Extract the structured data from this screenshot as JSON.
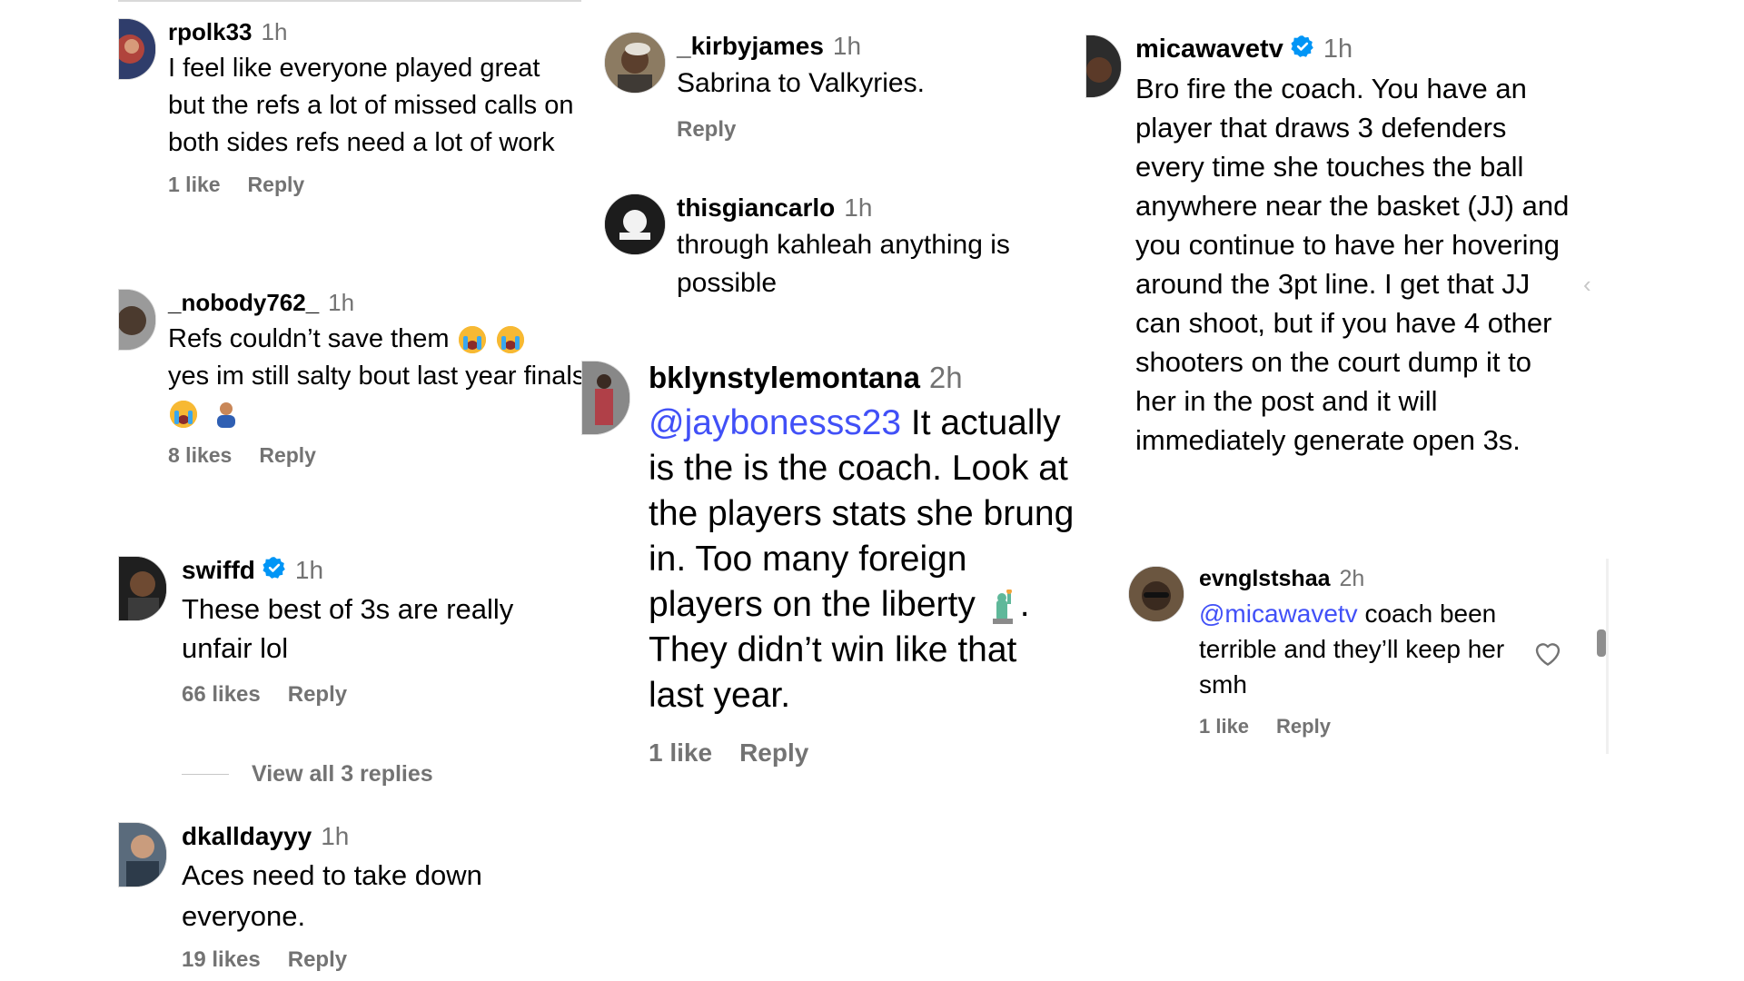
{
  "comments": [
    {
      "user": "rpolk33",
      "time": "1h",
      "text": "I feel like everyone played great but the refs a lot of missed calls on both sides refs need a lot of work",
      "likes": "1 like",
      "reply": "Reply"
    },
    {
      "user": "_nobody762_",
      "time": "1h",
      "text_1": "Refs couldn’t save them",
      "text_2": "yes im still salty bout last year finals",
      "likes": "8 likes",
      "reply": "Reply"
    },
    {
      "user": "swiffd",
      "time": "1h",
      "text": "These best of 3s are really unfair lol",
      "likes": "66 likes",
      "reply": "Reply",
      "view_replies": "View all 3 replies"
    },
    {
      "user": "dkalldayyy",
      "time": "1h",
      "text": "Aces need to take down everyone.",
      "likes": "19 likes",
      "reply": "Reply"
    },
    {
      "user": "_kirbyjames",
      "time": "1h",
      "text": "Sabrina to Valkyries.",
      "reply": "Reply"
    },
    {
      "user": "thisgiancarlo",
      "time": "1h",
      "text": "through kahleah anything is possible"
    },
    {
      "user": "bklynstylemontana",
      "time": "2h",
      "mention": "@jaybonesss23",
      "text_1": " It actually is the is the coach. Look at the players stats she brung in. Too many foreign players on the liberty ",
      "text_2": ". They didn’t win like that last year.",
      "likes": "1 like",
      "reply": "Reply"
    },
    {
      "user": "micawavetv",
      "time": "1h",
      "text": "Bro fire the coach. You have an player that draws 3 defenders every time she touches the ball anywhere near the basket (JJ) and you continue to have her hovering around the 3pt line. I get that JJ can shoot, but if you have 4 other shooters on the court dump it to her in the post and it will immediately generate open 3s."
    },
    {
      "user": "evnglstshaa",
      "time": "2h",
      "mention": "@micawavetv",
      "text": " coach been terrible and they’ll keep her smh",
      "likes": "1 like",
      "reply": "Reply"
    }
  ],
  "icons": {
    "verified": "verified-badge-icon",
    "heart": "heart-icon",
    "crying_emoji": "loudly-crying-face-emoji",
    "person_emoji": "person-emoji",
    "statue_emoji": "statue-of-liberty-emoji",
    "chevron": "chevron-left-icon"
  },
  "colors": {
    "mention": "#4150f7",
    "verified": "#0095f6",
    "muted": "#737373"
  }
}
